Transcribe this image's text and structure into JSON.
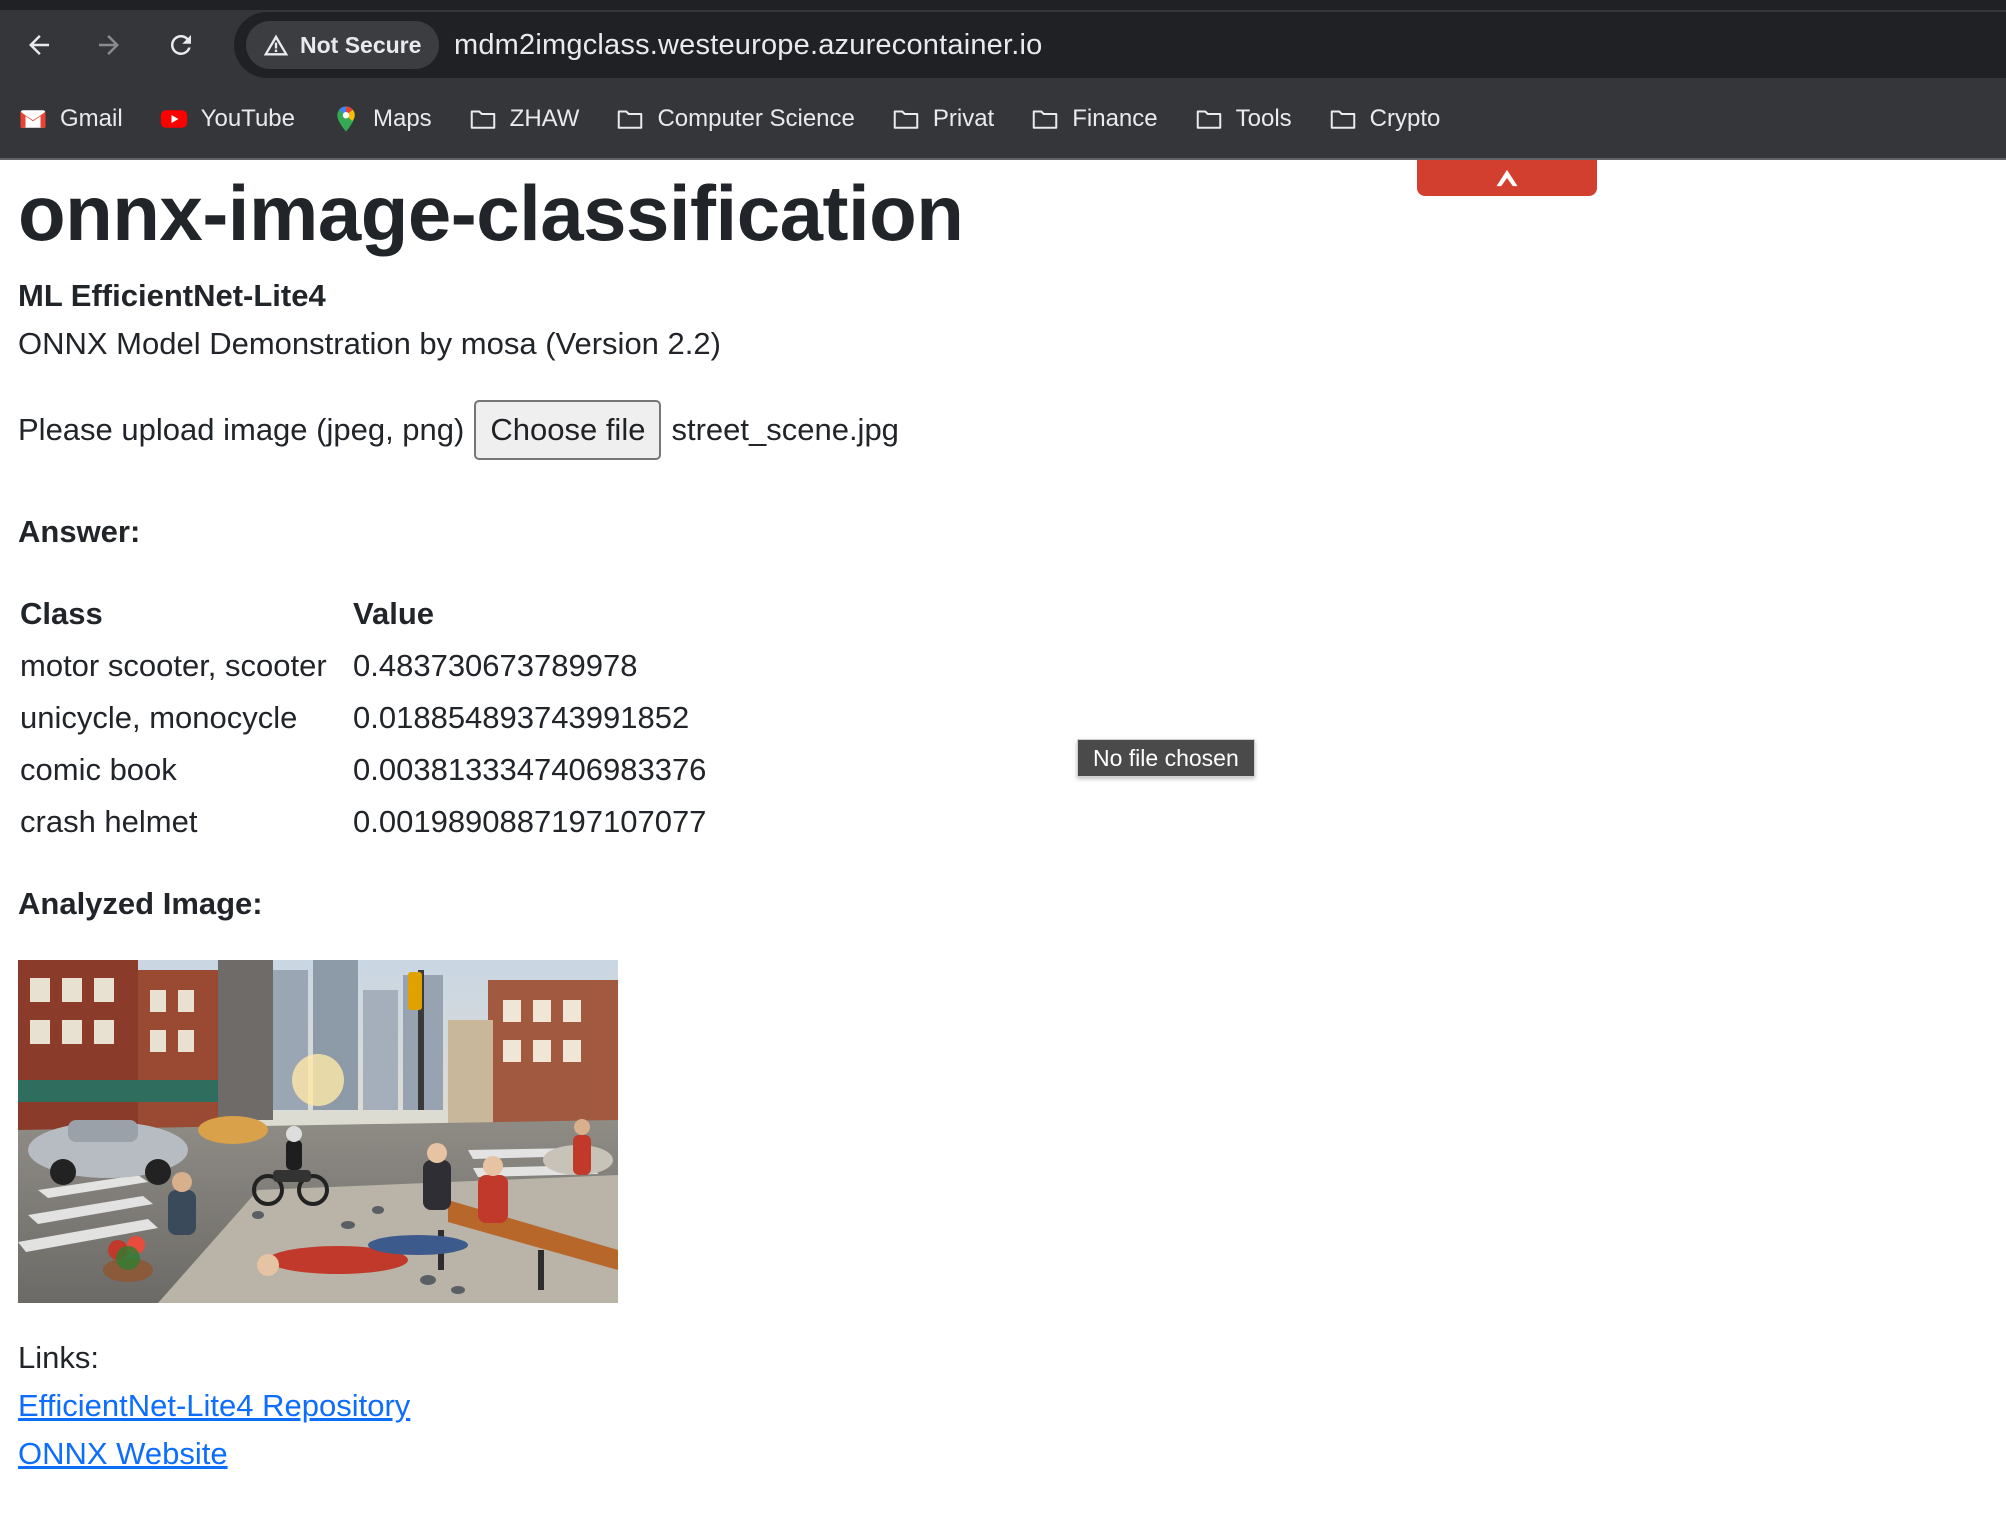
{
  "browser": {
    "security_label": "Not Secure",
    "url": "mdm2imgclass.westeurope.azurecontainer.io",
    "bookmarks": [
      {
        "label": "Gmail",
        "icon": "gmail-icon"
      },
      {
        "label": "YouTube",
        "icon": "youtube-icon"
      },
      {
        "label": "Maps",
        "icon": "maps-icon"
      },
      {
        "label": "ZHAW",
        "icon": "folder-icon"
      },
      {
        "label": "Computer Science",
        "icon": "folder-icon"
      },
      {
        "label": "Privat",
        "icon": "folder-icon"
      },
      {
        "label": "Finance",
        "icon": "folder-icon"
      },
      {
        "label": "Tools",
        "icon": "folder-icon"
      },
      {
        "label": "Crypto",
        "icon": "folder-icon"
      }
    ]
  },
  "page": {
    "title": "onnx-image-classification",
    "subtitle": "ML EfficientNet-Lite4",
    "description": "ONNX Model Demonstration by mosa (Version 2.2)",
    "upload": {
      "label": "Please upload image (jpeg, png)",
      "button_label": "Choose file",
      "file_name": "street_scene.jpg",
      "tooltip": "No file chosen"
    },
    "answer": {
      "heading": "Answer:",
      "columns": [
        "Class",
        "Value"
      ],
      "rows": [
        {
          "class": "motor scooter, scooter",
          "value": "0.483730673789978"
        },
        {
          "class": "unicycle, monocycle",
          "value": "0.018854893743991852"
        },
        {
          "class": "comic book",
          "value": "0.0038133347406983376"
        },
        {
          "class": "crash helmet",
          "value": "0.0019890887197107077"
        }
      ]
    },
    "analyzed_heading": "Analyzed Image:",
    "links": {
      "label": "Links:",
      "items": [
        {
          "label": "EfficientNet-Lite4 Repository"
        },
        {
          "label": "ONNX Website"
        }
      ]
    }
  },
  "colors": {
    "chrome_bg": "#35363a",
    "omnibox_bg": "#202124",
    "link": "#0d6efd",
    "extension_badge": "#d33f2f"
  }
}
